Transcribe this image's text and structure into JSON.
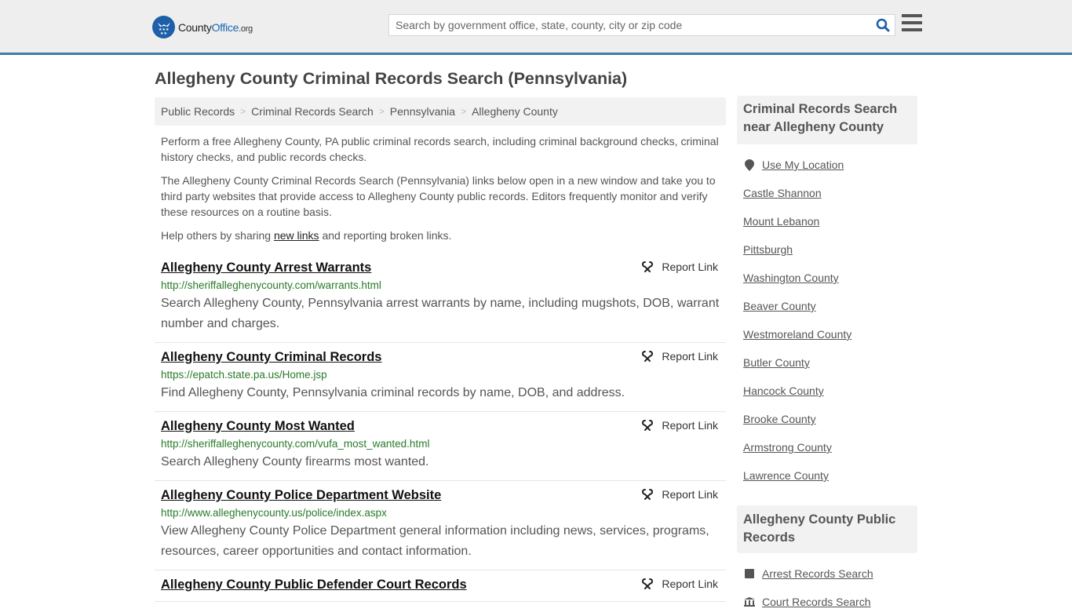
{
  "header": {
    "logo": {
      "brand_main": "County",
      "brand_accent": "Office",
      "brand_suffix": ".org"
    },
    "search": {
      "placeholder": "Search by government office, state, county, city or zip code",
      "value": ""
    },
    "icons": {
      "search": "search-icon",
      "menu": "hamburger-menu-icon"
    }
  },
  "page": {
    "title": "Allegheny County Criminal Records Search (Pennsylvania)",
    "breadcrumb": [
      {
        "label": "Public Records"
      },
      {
        "label": "Criminal Records Search"
      },
      {
        "label": "Pennsylvania"
      },
      {
        "label": "Allegheny County"
      }
    ],
    "breadcrumb_separator": ">",
    "intro": {
      "p1": "Perform a free Allegheny County, PA public criminal records search, including criminal background checks, criminal history checks, and public records checks.",
      "p2": "The Allegheny County Criminal Records Search (Pennsylvania) links below open in a new window and take you to third party websites that provide access to Allegheny County public records. Editors frequently monitor and verify these resources on a routine basis.",
      "p3_before": "Help others by sharing ",
      "p3_link": "new links",
      "p3_after": " and reporting broken links."
    },
    "report_label": "Report Link",
    "results": [
      {
        "title": "Allegheny County Arrest Warrants",
        "url": "http://sheriffalleghenycounty.com/warrants.html",
        "description": "Search Allegheny County, Pennsylvania arrest warrants by name, including mugshots, DOB, warrant number and charges."
      },
      {
        "title": "Allegheny County Criminal Records",
        "url": "https://epatch.state.pa.us/Home.jsp",
        "description": "Find Allegheny County, Pennsylvania criminal records by name, DOB, and address."
      },
      {
        "title": "Allegheny County Most Wanted",
        "url": "http://sheriffalleghenycounty.com/vufa_most_wanted.html",
        "description": "Search Allegheny County firearms most wanted."
      },
      {
        "title": "Allegheny County Police Department Website",
        "url": "http://www.alleghenycounty.us/police/index.aspx",
        "description": "View Allegheny County Police Department general information including news, services, programs, resources, career opportunities and contact information."
      },
      {
        "title": "Allegheny County Public Defender Court Records",
        "url": "",
        "description": ""
      }
    ]
  },
  "sidebar": {
    "nearby": {
      "heading": "Criminal Records Search near Allegheny County",
      "use_location": "Use My Location",
      "items": [
        "Castle Shannon",
        "Mount Lebanon",
        "Pittsburgh",
        "Washington County",
        "Beaver County",
        "Westmoreland County",
        "Butler County",
        "Hancock County",
        "Brooke County",
        "Armstrong County",
        "Lawrence County"
      ]
    },
    "public_records": {
      "heading": "Allegheny County Public Records",
      "items": [
        {
          "label": "Arrest Records Search",
          "icon": "square-icon"
        },
        {
          "label": "Court Records Search",
          "icon": "courthouse-icon"
        }
      ]
    }
  },
  "colors": {
    "header_bg": "#eeeeee",
    "header_border": "#3a7bb0",
    "brand_blue": "#1d66b3",
    "url_green": "#2a7a2a",
    "sidebar_box_bg": "#f2f2f2"
  }
}
